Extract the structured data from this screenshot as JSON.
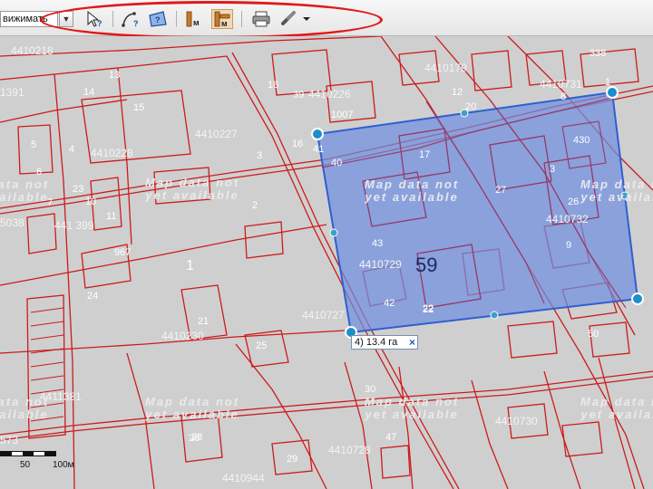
{
  "toolbar": {
    "mode_value": "вижимать",
    "tools": [
      {
        "name": "info-tool",
        "icon": "pointer-question-icon"
      },
      {
        "name": "measure-distance-tool",
        "icon": "measure-curve-icon"
      },
      {
        "name": "measure-area-tool",
        "icon": "area-icon"
      },
      {
        "name": "layer-m-tool",
        "icon": "ruler-m-icon"
      },
      {
        "name": "layer-m-active-tool",
        "icon": "ruler-m-active-icon"
      },
      {
        "name": "print-tool",
        "icon": "printer-icon"
      },
      {
        "name": "link-tool",
        "icon": "chain-link-icon"
      }
    ]
  },
  "map": {
    "watermark": [
      "Map data not",
      "yet available"
    ],
    "measurement_label": "4) 13.4 га",
    "close_glyph": "×",
    "parcel_big_label": "59",
    "quarters": [
      "4410218",
      "4410179",
      "4410226",
      "4410731",
      "1391",
      "4410228",
      "4410227",
      "4410732",
      "441 399",
      "4410729",
      "4410727",
      "4410230",
      "4411381",
      "4410730",
      "4410728",
      "4410944",
      "5038",
      "573"
    ],
    "parcels": [
      "14",
      "13",
      "18",
      "39",
      "15",
      "16",
      "41",
      "3",
      "4",
      "5",
      "6",
      "7",
      "10",
      "11",
      "23",
      "21",
      "2",
      "1",
      "24",
      "25",
      "28",
      "29",
      "30",
      "42",
      "17",
      "22",
      "26",
      "27",
      "28",
      "430",
      "338",
      "20",
      "40",
      "43",
      "12",
      "8",
      "9",
      "967",
      "1007",
      "50",
      "1",
      "3",
      "47",
      "22"
    ],
    "scale": {
      "zero": "0",
      "fifty": "50",
      "hundred": "100м"
    },
    "colors": {
      "boundary": "#cc1b1b",
      "selection_fill": "#6f8fe0",
      "selection_stroke": "#2f5fd0",
      "vertex": "#1c8fc8",
      "highlight": "#e01a1a"
    }
  }
}
